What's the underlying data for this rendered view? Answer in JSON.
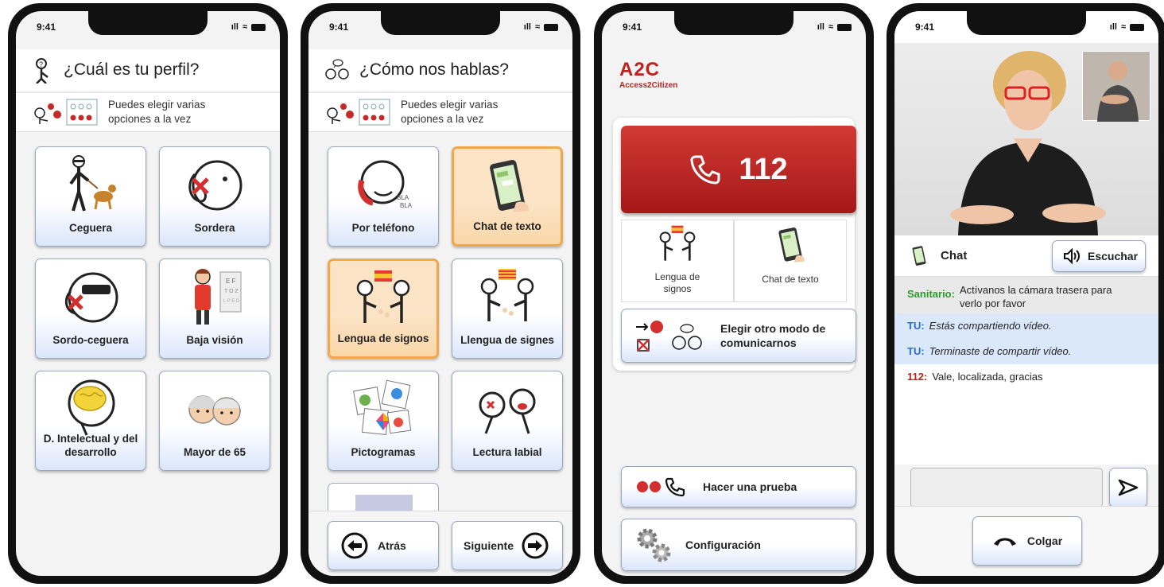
{
  "status": {
    "time": "9:41",
    "signal": "ıll",
    "wifi": "≈"
  },
  "screen1": {
    "title": "¿Cuál es tu perfil?",
    "hint": "Puedes elegir varias opciones a la vez",
    "tiles": [
      {
        "label": "Ceguera",
        "icon": "blind-person-icon"
      },
      {
        "label": "Sordera",
        "icon": "deaf-ear-icon"
      },
      {
        "label": "Sordo-ceguera",
        "icon": "deafblind-icon"
      },
      {
        "label": "Baja visión",
        "icon": "low-vision-icon"
      },
      {
        "label": "D. Intelectual y del desarrollo",
        "icon": "brain-icon"
      },
      {
        "label": "Mayor de 65",
        "icon": "elderly-couple-icon"
      }
    ]
  },
  "screen2": {
    "title": "¿Cómo nos hablas?",
    "hint": "Puedes elegir varias opciones a la vez",
    "tiles": [
      {
        "label": "Por teléfono",
        "selected": false,
        "icon": "phone-talk-icon"
      },
      {
        "label": "Chat de texto",
        "selected": true,
        "icon": "text-chat-phone-icon"
      },
      {
        "label": "Lengua de signos",
        "selected": true,
        "icon": "sign-language-es-icon"
      },
      {
        "label": "Llengua de signes",
        "selected": false,
        "icon": "sign-language-ca-icon"
      },
      {
        "label": "Pictogramas",
        "selected": false,
        "icon": "pictograms-icon"
      },
      {
        "label": "Lectura labial",
        "selected": false,
        "icon": "lip-reading-icon"
      }
    ],
    "back": "Atrás",
    "next": "Siguiente"
  },
  "screen3": {
    "logo": "A2C",
    "logo_sub": "Access2Citizen",
    "call_number": "112",
    "modes": [
      "Lengua de signos",
      "Chat de texto"
    ],
    "other_mode": "Elegir otro modo de comunicarnos",
    "test": "Hacer una prueba",
    "config": "Configuración"
  },
  "screen4": {
    "chat_label": "Chat",
    "listen": "Escuchar",
    "messages": [
      {
        "who": "Sanitario:",
        "text": "Actívanos la cámara trasera para verlo por favor",
        "italic": false
      },
      {
        "who": "TU:",
        "text": "Estás compartiendo vídeo.",
        "italic": true
      },
      {
        "who": "TU:",
        "text": "Terminaste de compartir vídeo.",
        "italic": true
      },
      {
        "who": "112:",
        "text": "Vale, localizada, gracias",
        "italic": false
      }
    ],
    "hangup": "Colgar"
  },
  "colors": {
    "accent_red": "#c0201b",
    "selected_orange": "#f2a74e",
    "tile_blue": "#dbe6fb",
    "sanitario_green": "#2e9a2e",
    "tu_blue": "#2a6fc9"
  }
}
